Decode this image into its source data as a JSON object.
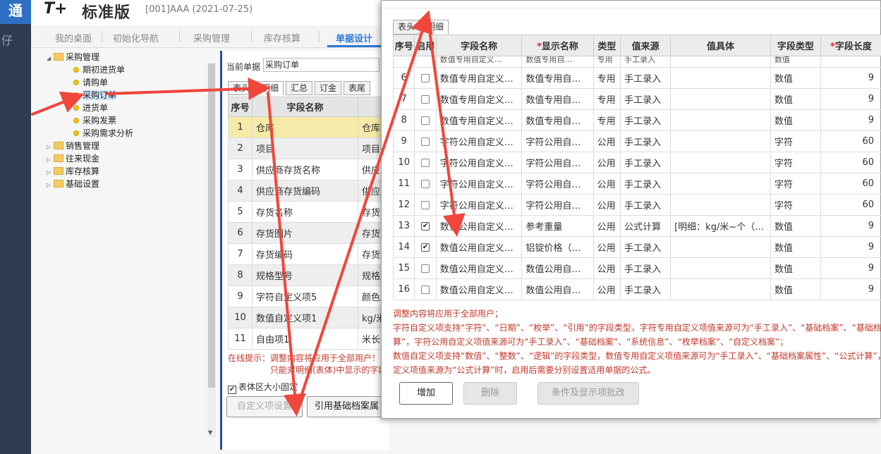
{
  "rail": {
    "logo": "通",
    "glyph": "仔"
  },
  "header": {
    "brand": "T+",
    "product": "标准版",
    "account": "[001]AAA   (2021-07-25)"
  },
  "nav": {
    "tabs": [
      "我的桌面",
      "初始化导航",
      "采购管理",
      "库存核算",
      "单据设计"
    ],
    "active": "单据设计"
  },
  "tree": {
    "root": "采购管理",
    "children": [
      "期初进货单",
      "请购单",
      "采购订单",
      "进货单",
      "采购发票",
      "采购需求分析"
    ],
    "selected": "采购订单",
    "others": [
      "销售管理",
      "往来现金",
      "库存核算",
      "基础设置"
    ]
  },
  "editor": {
    "current_label": "当前单据",
    "current_value": "采购订单",
    "tabs": [
      "表头",
      "明细",
      "汇总",
      "订金",
      "表尾"
    ],
    "active_tab": "明细",
    "columns": [
      "序号",
      "字段名称",
      ""
    ],
    "rows": [
      [
        "1",
        "仓库",
        "仓库"
      ],
      [
        "2",
        "项目",
        "项目"
      ],
      [
        "3",
        "供应商存货名称",
        "供应"
      ],
      [
        "4",
        "供应商存货编码",
        "供应"
      ],
      [
        "5",
        "存货名称",
        "存货名"
      ],
      [
        "6",
        "存货图片",
        "存货图"
      ],
      [
        "7",
        "存货编码",
        "存货编"
      ],
      [
        "8",
        "规格型号",
        "规格型"
      ],
      [
        "9",
        "字符自定义项5",
        "颜色"
      ],
      [
        "10",
        "数值自定义项1",
        "kg/米"
      ],
      [
        "11",
        "自由项1",
        "米长"
      ]
    ],
    "online_tip_1": "在线提示：调整内容将应用于全部用户！",
    "online_tip_2": "只能对明细(表体)中显示的字段",
    "fixed_size_label": "表体区大小固定",
    "btn_custom": "自定义项设置",
    "btn_ref": "引用基础档案属"
  },
  "dialog": {
    "tabs": [
      "表头",
      "明细"
    ],
    "active_tab": "明细",
    "columns": [
      "序号",
      "启用",
      "字段名称",
      "显示名称",
      "类型",
      "值来源",
      "值具体",
      "字段类型",
      "字段长度"
    ],
    "required_columns": [
      "显示名称",
      "字段长度"
    ],
    "cut_row": [
      "",
      "",
      "数值专用自定义…",
      "数值专用自…",
      "专用",
      "手工录入",
      "",
      "数值",
      ""
    ],
    "rows": [
      {
        "no": "6",
        "enabled": false,
        "field": "数值专用自定义…",
        "display": "数值专用自…",
        "type": "专用",
        "source": "手工录入",
        "value": "",
        "ftype": "数值",
        "len": "9"
      },
      {
        "no": "7",
        "enabled": false,
        "field": "数值专用自定义…",
        "display": "数值专用自…",
        "type": "专用",
        "source": "手工录入",
        "value": "",
        "ftype": "数值",
        "len": "9"
      },
      {
        "no": "8",
        "enabled": false,
        "field": "数值专用自定义…",
        "display": "数值专用自…",
        "type": "专用",
        "source": "手工录入",
        "value": "",
        "ftype": "数值",
        "len": "9"
      },
      {
        "no": "9",
        "enabled": false,
        "field": "字符公用自定义…",
        "display": "字符公用自…",
        "type": "公用",
        "source": "手工录入",
        "value": "",
        "ftype": "字符",
        "len": "60"
      },
      {
        "no": "10",
        "enabled": false,
        "field": "字符公用自定义…",
        "display": "字符公用自…",
        "type": "公用",
        "source": "手工录入",
        "value": "",
        "ftype": "字符",
        "len": "60"
      },
      {
        "no": "11",
        "enabled": false,
        "field": "字符公用自定义…",
        "display": "字符公用自…",
        "type": "公用",
        "source": "手工录入",
        "value": "",
        "ftype": "字符",
        "len": "60"
      },
      {
        "no": "12",
        "enabled": false,
        "field": "字符公用自定义…",
        "display": "字符公用自…",
        "type": "公用",
        "source": "手工录入",
        "value": "",
        "ftype": "字符",
        "len": "60"
      },
      {
        "no": "13",
        "enabled": true,
        "field": "数值公用自定义…",
        "display": "参考重量",
        "type": "公用",
        "source": "公式计算",
        "value": "[明细：kg/米~个（…",
        "ftype": "数值",
        "len": "9"
      },
      {
        "no": "14",
        "enabled": true,
        "field": "数值公用自定义…",
        "display": "铝锭价格（…",
        "type": "公用",
        "source": "手工录入",
        "value": "",
        "ftype": "数值",
        "len": "9"
      },
      {
        "no": "15",
        "enabled": false,
        "field": "数值公用自定义…",
        "display": "数值公用自…",
        "type": "公用",
        "source": "手工录入",
        "value": "",
        "ftype": "数值",
        "len": "9"
      },
      {
        "no": "16",
        "enabled": false,
        "field": "数值公用自定义…",
        "display": "数值公用自…",
        "type": "公用",
        "source": "手工录入",
        "value": "",
        "ftype": "数值",
        "len": "9"
      }
    ],
    "notes": [
      "调整内容将应用于全部用户；",
      "字符自定义项支持“字符”、“日期”、“枚举”、“引用”的字段类型，字符专用自定义项值来源可为“手工录入”、“基础档案”、“基础档案属性",
      "算”，字符公用自定义项值来源可为“手工录入”、“基础档案”、“系统信息”、“枚举档案”、“自定义档案”；",
      "数值自定义项支持“数值”、“整数”、“逻辑”的字段类型，数值专用自定义项值来源可为“手工录入”、“基础档案属性”、“公式计算”，数值",
      "定义项值来源为“公式计算”时，启用后需要分别设置适用单据的公式。"
    ],
    "btn_add": "增加",
    "btn_delete": "删除",
    "btn_cond": "条件及显示项批改"
  },
  "colors": {
    "accent": "#2e78d6",
    "arrow": "#f0463c",
    "tip": "#c0392b",
    "rail": "#2f3d50"
  }
}
